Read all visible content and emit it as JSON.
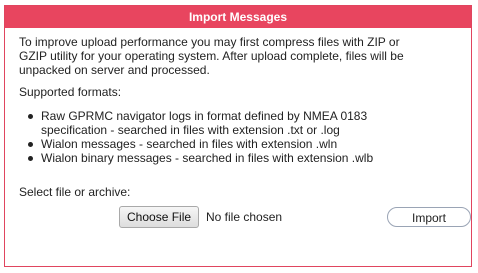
{
  "dialog": {
    "title": "Import Messages",
    "intro_line_1": "To improve upload performance you may first compress files with ZIP or",
    "intro_line_2": "GZIP utility for your operating system. After upload complete, files will be",
    "intro_line_3": "unpacked on server and processed.",
    "supported_label": "Supported formats:",
    "formats": [
      {
        "line_1": "Raw GPRMC navigator logs in format defined by NMEA 0183",
        "line_2": "specification - searched in files with extension .txt or .log"
      },
      {
        "line_1": "Wialon messages - searched in files with extension .wln"
      },
      {
        "line_1": "Wialon binary messages - searched in files with extension .wlb"
      }
    ],
    "select_label": "Select file or archive:",
    "choose_file_label": "Choose File",
    "file_status": "No file chosen",
    "import_label": "Import"
  },
  "colors": {
    "title_bar": "#e8455f",
    "title_text": "#ffffff",
    "body_text": "#222222"
  }
}
